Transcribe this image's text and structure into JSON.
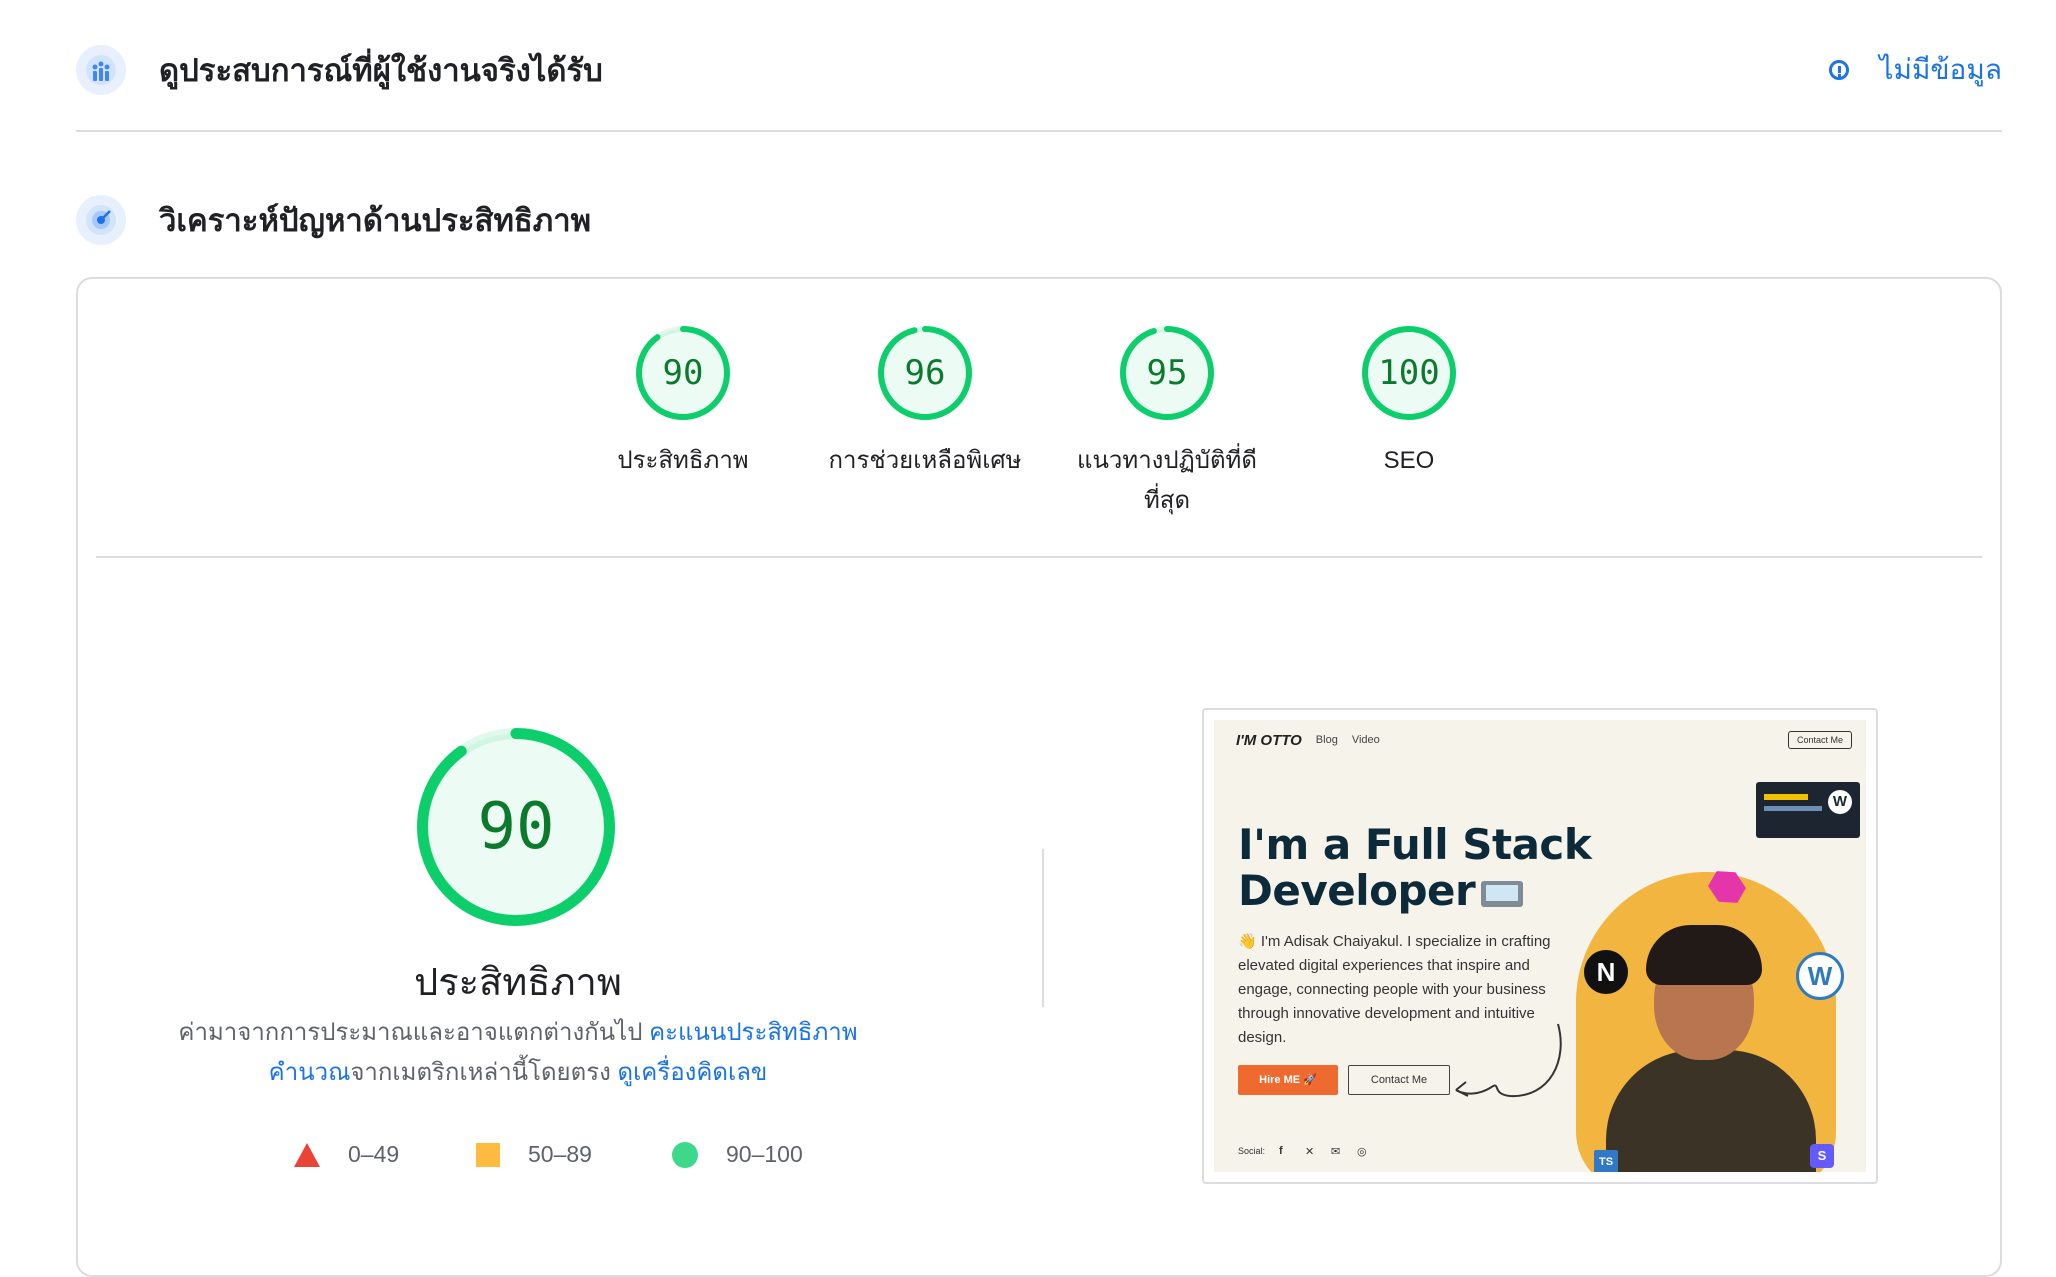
{
  "crux_section": {
    "title": "ดูประสบการณ์ที่ผู้ใช้งานจริงได้รับ",
    "no_data_label": "ไม่มีข้อมูล"
  },
  "diagnose_section": {
    "title": "วิเคราะห์ปัญหาด้านประสิทธิภาพ"
  },
  "categories": [
    {
      "score": "90",
      "label": "ประสิทธิภาพ",
      "value": 90
    },
    {
      "score": "96",
      "label": "การช่วยเหลือพิเศษ",
      "value": 96
    },
    {
      "score": "95",
      "label": "แนวทางปฏิบัติที่ดีที่สุด",
      "value": 95
    },
    {
      "score": "100",
      "label": "SEO",
      "value": 100
    }
  ],
  "performance": {
    "score": "90",
    "value": 90,
    "title": "ประสิทธิภาพ",
    "desc_prefix": "ค่ามาจากการประมาณและอาจแตกต่างกันไป ",
    "desc_link1": "คะแนนประสิทธิภาพคำนวณ",
    "desc_middle": "จากเมตริกเหล่านี้โดยตรง ",
    "desc_link2": "ดูเครื่องคิดเลข"
  },
  "legend": {
    "fail": "0–49",
    "average": "50–89",
    "pass": "90–100"
  },
  "colors": {
    "pass": "#0cce6b",
    "pass_text": "#0c7a2d",
    "average": "#ffa400",
    "fail": "#eb4335",
    "link": "#1a73e8"
  },
  "screenshot": {
    "logo": "I'M OTTO",
    "nav_blog": "Blog",
    "nav_video": "Video",
    "nav_contact": "Contact Me",
    "headline_1": "I'm a Full Stack",
    "headline_2": "Developer",
    "intro": "👋 I'm Adisak Chaiyakul. I specialize in crafting elevated digital experiences that inspire and engage, connecting people with your business through innovative development and intuitive design.",
    "hire_button": "Hire ME 🚀",
    "contact_button": "Contact Me",
    "social_label": "Social:"
  }
}
